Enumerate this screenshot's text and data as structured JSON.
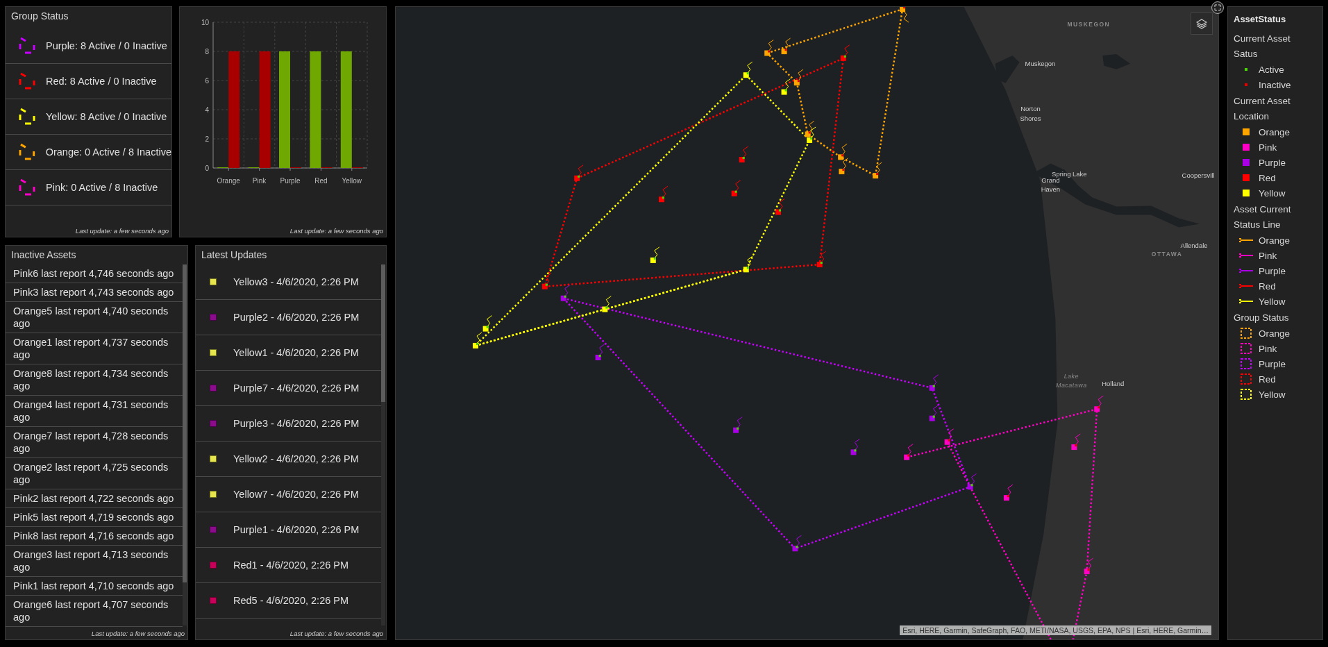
{
  "group_status": {
    "title": "Group Status",
    "footer": "Last update: a few seconds ago",
    "items": [
      {
        "label": "Purple: 8 Active / 0 Inactive",
        "color": "#c800ff"
      },
      {
        "label": "Red: 8 Active / 0 Inactive",
        "color": "#ff0000"
      },
      {
        "label": "Yellow: 8 Active / 0 Inactive",
        "color": "#ffff00"
      },
      {
        "label": "Orange: 0 Active / 8 Inactive",
        "color": "#ffa500"
      },
      {
        "label": "Pink: 0 Active / 8 Inactive",
        "color": "#ff00c8"
      }
    ]
  },
  "status_chart": {
    "footer": "Last update: a few seconds ago",
    "chart_data": {
      "type": "bar",
      "categories": [
        "Orange",
        "Pink",
        "Purple",
        "Red",
        "Yellow"
      ],
      "series": [
        {
          "color": "#6ea800",
          "values": [
            0,
            0,
            8,
            8,
            8
          ]
        },
        {
          "color": "#a80000",
          "values": [
            8,
            8,
            0,
            0,
            0
          ]
        }
      ],
      "grid": true,
      "ylim": [
        0,
        10
      ],
      "yticks": [
        0,
        2,
        4,
        6,
        8,
        10
      ]
    }
  },
  "inactive_assets": {
    "title": "Inactive Assets",
    "footer": "Last update: a few seconds ago",
    "items": [
      "Pink6 last report 4,746 seconds ago",
      "Pink3 last report 4,743 seconds ago",
      "Orange5 last report 4,740 seconds ago",
      "Orange1 last report 4,737 seconds ago",
      "Orange8 last report 4,734 seconds ago",
      "Orange4 last report 4,731 seconds ago",
      "Orange7 last report 4,728 seconds ago",
      "Orange2 last report 4,725 seconds ago",
      "Pink2 last report 4,722 seconds ago",
      "Pink5 last report 4,719 seconds ago",
      "Pink8 last report 4,716 seconds ago",
      "Orange3 last report 4,713 seconds ago",
      "Pink1 last report 4,710 seconds ago",
      "Orange6 last report 4,707 seconds ago"
    ]
  },
  "latest_updates": {
    "title": "Latest Updates",
    "footer": "Last update: a few seconds ago",
    "items": [
      {
        "label": "Yellow3 - 4/6/2020, 2:26 PM",
        "color": "#e6e64c"
      },
      {
        "label": "Purple2 - 4/6/2020, 2:26 PM",
        "color": "#8c0a8c"
      },
      {
        "label": "Yellow1 - 4/6/2020, 2:26 PM",
        "color": "#e6e64c"
      },
      {
        "label": "Purple7 - 4/6/2020, 2:26 PM",
        "color": "#8c0a8c"
      },
      {
        "label": "Purple3 - 4/6/2020, 2:26 PM",
        "color": "#8c0a8c"
      },
      {
        "label": "Yellow2 - 4/6/2020, 2:26 PM",
        "color": "#e6e64c"
      },
      {
        "label": "Yellow7 - 4/6/2020, 2:26 PM",
        "color": "#e6e64c"
      },
      {
        "label": "Purple1 - 4/6/2020, 2:26 PM",
        "color": "#8c0a8c"
      },
      {
        "label": "Red1 - 4/6/2020, 2:26 PM",
        "color": "#c8005a"
      },
      {
        "label": "Red5 - 4/6/2020, 2:26 PM",
        "color": "#c8005a"
      }
    ]
  },
  "map": {
    "attribution": "Esri, HERE, Garmin, SafeGraph, FAO, METI/NASA, USGS, EPA, NPS | Esri, HERE, Garmin…",
    "labels": [
      {
        "text": "MUSKEGON",
        "kind": "region"
      },
      {
        "text": "Muskegon",
        "kind": "city"
      },
      {
        "text": "Norton",
        "kind": "city"
      },
      {
        "text": "Shores",
        "kind": "city"
      },
      {
        "text": "Spring Lake",
        "kind": "city"
      },
      {
        "text": "Grand",
        "kind": "city"
      },
      {
        "text": "Haven",
        "kind": "city"
      },
      {
        "text": "Coopersvill",
        "kind": "city"
      },
      {
        "text": "Allendale",
        "kind": "city"
      },
      {
        "text": "OTTAWA",
        "kind": "region"
      },
      {
        "text": "Lake",
        "kind": "water"
      },
      {
        "text": "Macatawa",
        "kind": "water"
      },
      {
        "text": "Holland",
        "kind": "city"
      }
    ]
  },
  "legend": {
    "title": "AssetStatus",
    "sections": [
      {
        "heading": "Current Asset Satus",
        "items": [
          {
            "label": "Active",
            "kind": "dot",
            "color": "#4cd600"
          },
          {
            "label": "Inactive",
            "kind": "dot",
            "color": "#e60000"
          }
        ]
      },
      {
        "heading": "Current Asset Location",
        "items": [
          {
            "label": "Orange",
            "kind": "square",
            "color": "#ffa500"
          },
          {
            "label": "Pink",
            "kind": "square",
            "color": "#ff00c5"
          },
          {
            "label": "Purple",
            "kind": "square",
            "color": "#a900e6"
          },
          {
            "label": "Red",
            "kind": "square",
            "color": "#ff0000"
          },
          {
            "label": "Yellow",
            "kind": "square",
            "color": "#ffff00"
          }
        ]
      },
      {
        "heading": "Asset Current Status Line",
        "items": [
          {
            "label": "Orange",
            "kind": "line",
            "color": "#ffa500"
          },
          {
            "label": "Pink",
            "kind": "line",
            "color": "#ff00c5"
          },
          {
            "label": "Purple",
            "kind": "line",
            "color": "#a900e6"
          },
          {
            "label": "Red",
            "kind": "line",
            "color": "#ff0000"
          },
          {
            "label": "Yellow",
            "kind": "line",
            "color": "#ffff00"
          }
        ]
      },
      {
        "heading": "Group Status",
        "items": [
          {
            "label": "Orange",
            "kind": "dashed-box",
            "color": "#ffa500"
          },
          {
            "label": "Pink",
            "kind": "dashed-box",
            "color": "#ff00c5"
          },
          {
            "label": "Purple",
            "kind": "dashed-box",
            "color": "#c800ff"
          },
          {
            "label": "Red",
            "kind": "dashed-box",
            "color": "#ff0000"
          },
          {
            "label": "Yellow",
            "kind": "dashed-box",
            "color": "#ffff00"
          }
        ]
      }
    ]
  }
}
